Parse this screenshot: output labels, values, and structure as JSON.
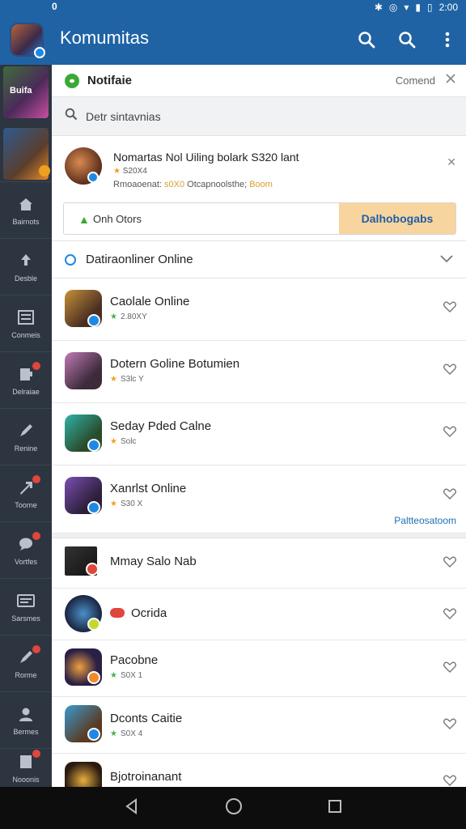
{
  "status_bar": {
    "left_icon": "0",
    "time": "2:00"
  },
  "app_bar": {
    "title": "Komumitas",
    "icons": [
      "search-icon",
      "search-icon",
      "more-vert-icon"
    ]
  },
  "sidebar": {
    "items": [
      {
        "label": "Bairnots",
        "icon": "home-icon",
        "badge": false
      },
      {
        "label": "Desble",
        "icon": "upload-icon",
        "badge": false
      },
      {
        "label": "Conmeis",
        "icon": "list-icon",
        "badge": false
      },
      {
        "label": "Delraiae",
        "icon": "door-icon",
        "badge": true
      },
      {
        "label": "Renine",
        "icon": "pen-icon",
        "badge": false
      },
      {
        "label": "Toorne",
        "icon": "arrow-icon",
        "badge": true
      },
      {
        "label": "Vortfes",
        "icon": "chat-icon",
        "badge": true
      },
      {
        "label": "Sarsmes",
        "icon": "card-icon",
        "badge": false
      },
      {
        "label": "Rorme",
        "icon": "pen-icon",
        "badge": true
      },
      {
        "label": "Bermes",
        "icon": "user-icon",
        "badge": false
      },
      {
        "label": "Nooonis",
        "icon": "doc-icon",
        "badge": true
      }
    ],
    "thumb_label": "Buifa"
  },
  "notification": {
    "label": "Notifaie",
    "meta": "Comend"
  },
  "search": {
    "placeholder": "Detr sintavnias"
  },
  "featured": {
    "title": "Nomartas Nol Uiling bolark S320 lant",
    "rating": "S20X4",
    "sub_prefix": "Rmoaoenat:",
    "sub_value": "s0X0",
    "sub_mid": "Otcapnoolsthe;",
    "sub_highlight": "Boom",
    "left_button": "Onh Otors",
    "right_button": "Dalhobogabs"
  },
  "section": {
    "label": "Datiraonliner Online"
  },
  "items": [
    {
      "name": "Caolale Online",
      "rating": "2.80XY",
      "star_color": "#4caf50",
      "extra": ""
    },
    {
      "name": "Dotern Goline Botumien",
      "rating": "S3lc Y",
      "star_color": "#f0a020",
      "extra": ""
    },
    {
      "name": "Seday Pded Calne",
      "rating": "Solc",
      "star_color": "#f0a020",
      "extra": ""
    },
    {
      "name": "Xanrlst Online",
      "rating": "S30 X",
      "star_color": "#f0a020",
      "extra": "Paltteosatoom"
    },
    {
      "name": "Mmay Salo Nab",
      "rating": "",
      "star_color": "",
      "extra": ""
    },
    {
      "name": "Ocrida",
      "rating": "",
      "star_color": "",
      "extra": ""
    },
    {
      "name": "Pacobne",
      "rating": "S0X 1",
      "star_color": "#4caf50",
      "extra": ""
    },
    {
      "name": "Dconts Caitie",
      "rating": "S0X 4",
      "star_color": "#4caf50",
      "extra": ""
    },
    {
      "name": "Bjotroinanant",
      "rating": "",
      "star_color": "",
      "extra": ""
    }
  ],
  "colors": {
    "brand": "#1f63a5",
    "sidebar": "#2c3540",
    "accent_orange": "#f8d59e",
    "link": "#1e6fb3"
  }
}
